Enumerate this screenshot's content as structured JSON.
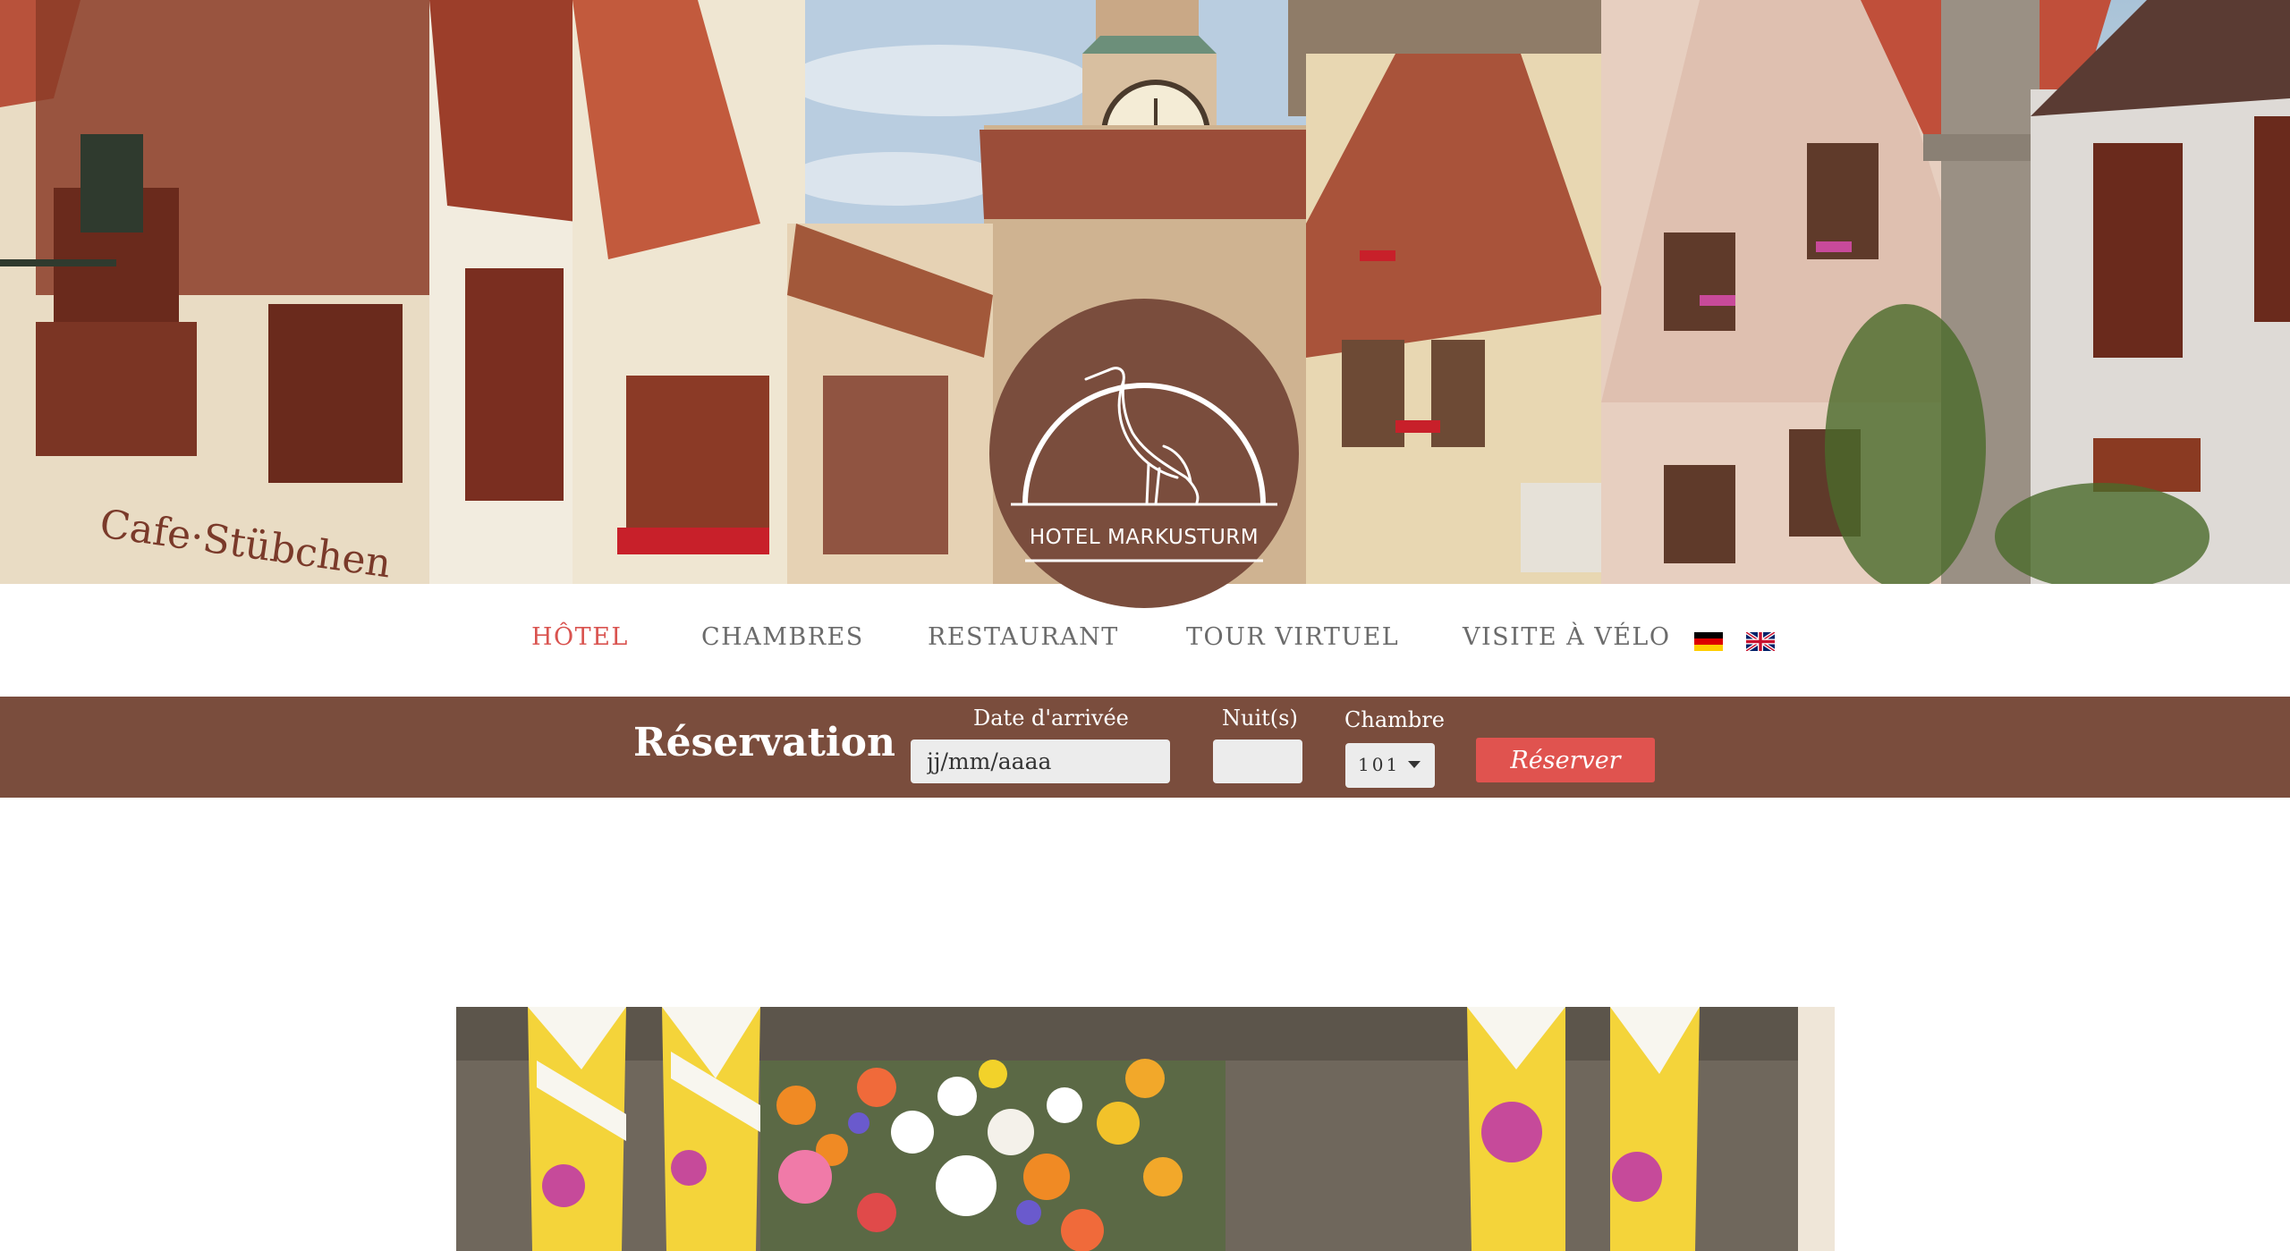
{
  "hotel": {
    "name": "HOTEL MARKUSTURM"
  },
  "nav": {
    "items": [
      {
        "label": "HÔTEL",
        "active": true
      },
      {
        "label": "CHAMBRES",
        "active": false
      },
      {
        "label": "RESTAURANT",
        "active": false
      },
      {
        "label": "TOUR VIRTUEL",
        "active": false
      },
      {
        "label": "VISITE À VÉLO",
        "active": false
      }
    ],
    "languages": [
      "de-flag-icon",
      "uk-flag-icon"
    ]
  },
  "reservation": {
    "title": "Réservation",
    "arrival_label": "Date d'arrivée",
    "arrival_placeholder": "jj/mm/aaaa",
    "nights_label": "Nuit(s)",
    "nights_value": "",
    "room_label": "Chambre",
    "room_value": "101",
    "button_label": "Réserver"
  },
  "colors": {
    "brand_brown": "#7a4d3d",
    "accent_red": "#e0534f",
    "active_nav": "#d9534f",
    "nav_text": "#6b6b6b"
  }
}
